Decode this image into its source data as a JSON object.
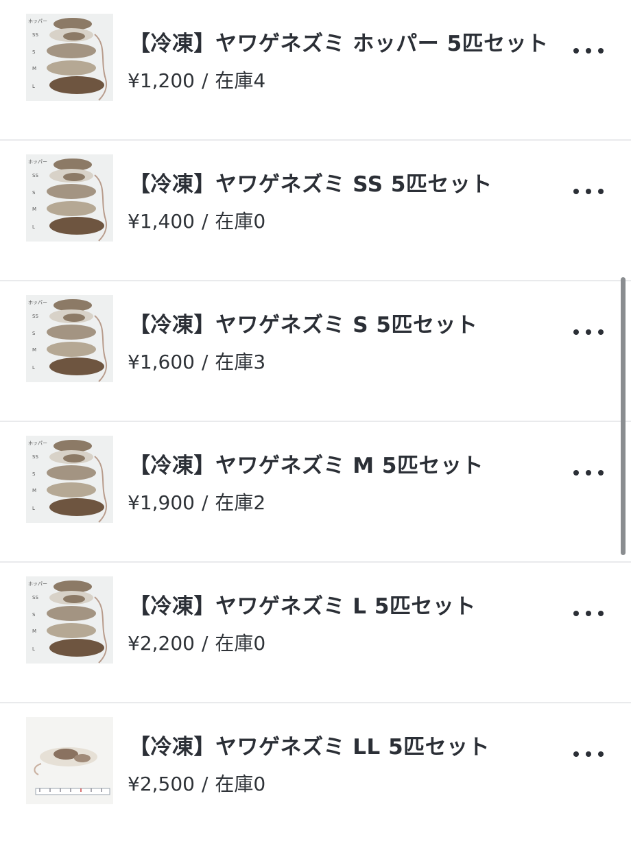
{
  "products": [
    {
      "title": "【冷凍】ヤワゲネズミ ホッパー 5匹セット",
      "price": "¥1,200",
      "stock": "在庫4",
      "thumb_labels": [
        "ホッパー",
        "SS",
        "S",
        "M",
        "L"
      ],
      "thumbnail_icon": "frozen-mice-size-lineup-photo"
    },
    {
      "title": "【冷凍】ヤワゲネズミ SS 5匹セット",
      "price": "¥1,400",
      "stock": "在庫0",
      "thumb_labels": [
        "ホッパー",
        "SS",
        "S",
        "M",
        "L"
      ],
      "thumbnail_icon": "frozen-mice-size-lineup-photo"
    },
    {
      "title": "【冷凍】ヤワゲネズミ S 5匹セット",
      "price": "¥1,600",
      "stock": "在庫3",
      "thumb_labels": [
        "ホッパー",
        "SS",
        "S",
        "M",
        "L"
      ],
      "thumbnail_icon": "frozen-mice-size-lineup-photo"
    },
    {
      "title": "【冷凍】ヤワゲネズミ M 5匹セット",
      "price": "¥1,900",
      "stock": "在庫2",
      "thumb_labels": [
        "ホッパー",
        "SS",
        "S",
        "M",
        "L"
      ],
      "thumbnail_icon": "frozen-mice-size-lineup-photo"
    },
    {
      "title": "【冷凍】ヤワゲネズミ L 5匹セット",
      "price": "¥2,200",
      "stock": "在庫0",
      "thumb_labels": [
        "ホッパー",
        "SS",
        "S",
        "M",
        "L"
      ],
      "thumbnail_icon": "frozen-mice-size-lineup-photo"
    },
    {
      "title": "【冷凍】ヤワゲネズミ LL 5匹セット",
      "price": "¥2,500",
      "stock": "在庫0",
      "thumb_labels": [],
      "thumbnail_icon": "frozen-mouse-with-ruler-photo"
    }
  ],
  "separator": "/",
  "more_icon": "more-horizontal-icon",
  "colors": {
    "text": "#2b2f36",
    "divider": "#e9eaec",
    "scrollbar": "#8a8d90"
  }
}
